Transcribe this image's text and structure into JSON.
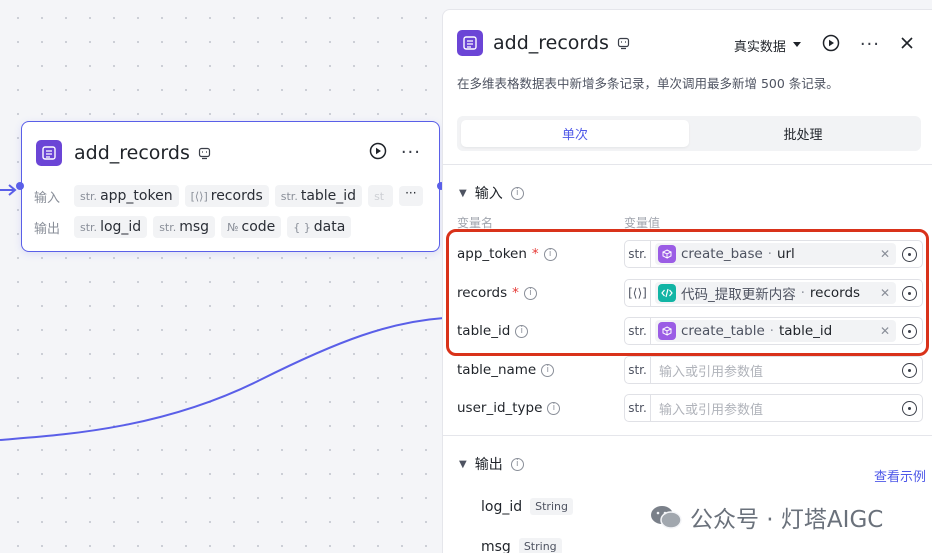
{
  "node": {
    "title": "add_records",
    "input_label": "输入",
    "output_label": "输出",
    "inputs": [
      {
        "type": "str.",
        "name": "app_token"
      },
      {
        "type": "[⟨⟩]",
        "name": "records"
      },
      {
        "type": "str.",
        "name": "table_id"
      },
      {
        "type": "st",
        "name": ""
      }
    ],
    "outputs": [
      {
        "type": "str.",
        "name": "log_id"
      },
      {
        "type": "str.",
        "name": "msg"
      },
      {
        "type": "№",
        "name": "code"
      },
      {
        "type": "{ }",
        "name": "data"
      }
    ],
    "more": "···"
  },
  "panel": {
    "title": "add_records",
    "data_mode": "真实数据",
    "description": "在多维表格数据表中新增多条记录，单次调用最多新增 500 条记录。",
    "tabs": [
      {
        "label": "单次",
        "active": true
      },
      {
        "label": "批处理",
        "active": false
      }
    ],
    "input_section": "输入",
    "col_name": "变量名",
    "col_value": "变量值",
    "params": [
      {
        "name": "app_token",
        "required": true,
        "type": "str.",
        "src": "create_base",
        "field": "url",
        "icon_color": "#9b5de5"
      },
      {
        "name": "records",
        "required": true,
        "type": "[⟨⟩]",
        "src": "代码_提取更新内容",
        "field": "records",
        "icon_color": "#12b5a5"
      },
      {
        "name": "table_id",
        "required": false,
        "type": "str.",
        "src": "create_table",
        "field": "table_id",
        "icon_color": "#9b5de5"
      },
      {
        "name": "table_name",
        "required": false,
        "type": "str.",
        "placeholder": "输入或引用参数值"
      },
      {
        "name": "user_id_type",
        "required": false,
        "type": "str.",
        "placeholder": "输入或引用参数值"
      }
    ],
    "output_section": "输出",
    "view_example": "查看示例",
    "outputs": [
      {
        "name": "log_id",
        "type": "String"
      },
      {
        "name": "msg",
        "type": "String"
      }
    ]
  },
  "watermark": "公众号 · 灯塔AIGC",
  "colors": {
    "accent": "#5a5fe8",
    "highlight": "#d9321a",
    "link": "#4e58e8"
  }
}
